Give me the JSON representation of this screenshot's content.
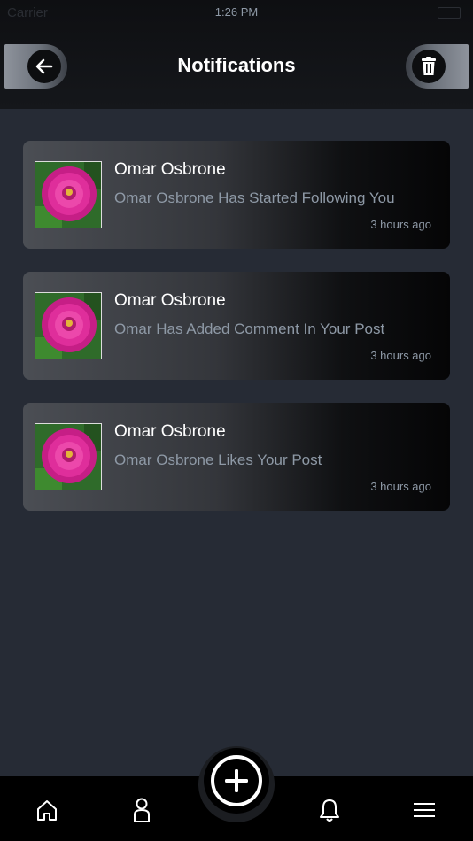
{
  "status_bar": {
    "carrier": "Carrier",
    "time": "1:26 PM"
  },
  "header": {
    "title": "Notifications"
  },
  "notifications": [
    {
      "name": "Omar Osbrone",
      "message": "Omar Osbrone Has Started Following You",
      "time": "3 hours ago"
    },
    {
      "name": "Omar Osbrone",
      "message": "Omar Has Added Comment In Your Post",
      "time": "3 hours ago"
    },
    {
      "name": "Omar Osbrone",
      "message": "Omar Osbrone Likes Your Post",
      "time": "3 hours ago"
    }
  ],
  "icons": {
    "back": "arrow-left-icon",
    "trash": "trash-icon",
    "home": "home-icon",
    "profile": "person-icon",
    "add": "plus-circle-icon",
    "notifications": "bell-icon",
    "menu": "menu-icon"
  },
  "colors": {
    "background": "#262b35",
    "accent_text": "#8e99a6"
  }
}
